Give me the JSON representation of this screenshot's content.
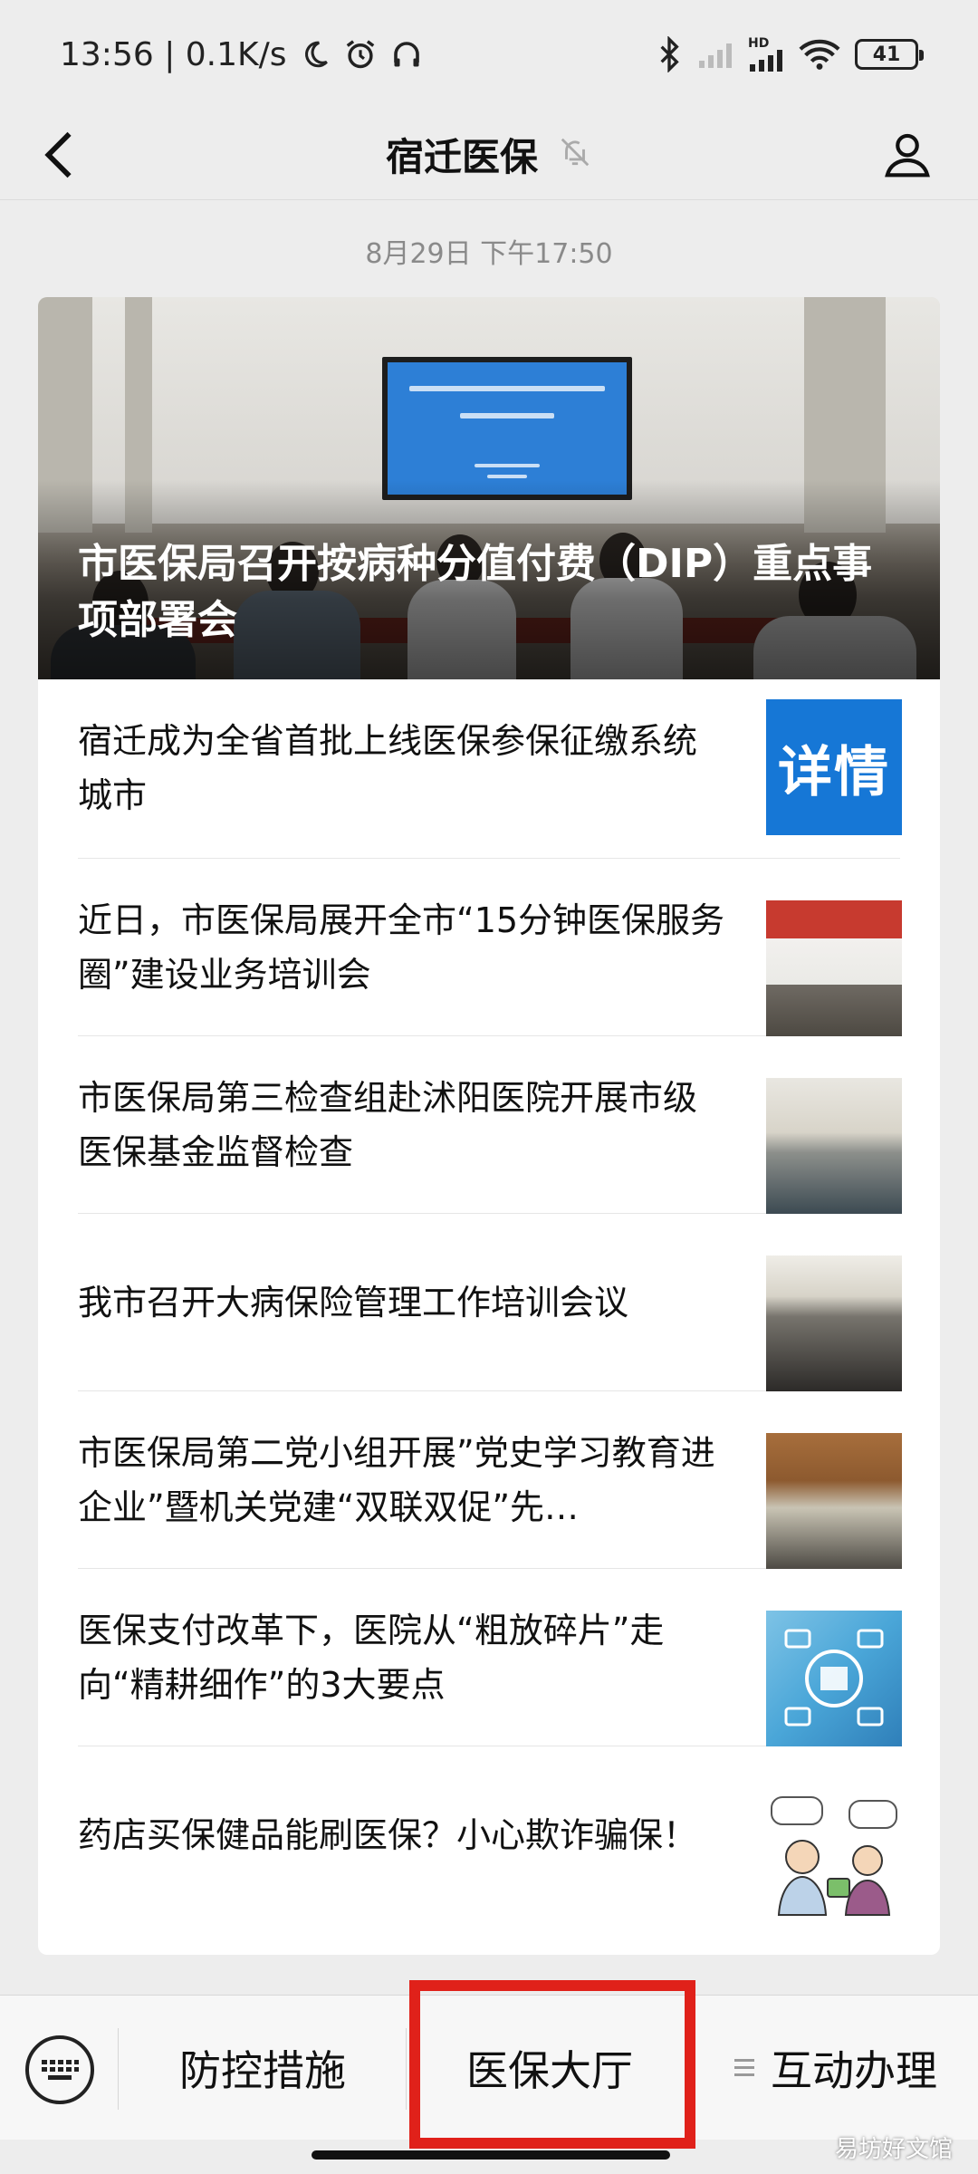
{
  "status_bar": {
    "time_speed": "13:56 | 0.1K/s",
    "network": "HD",
    "battery": "41"
  },
  "nav": {
    "title": "宿迁医保"
  },
  "timestamp": "8月29日 下午17:50",
  "hero": {
    "title": "市医保局召开按病种分值付费（DIP）重点事项部署会"
  },
  "news": [
    {
      "title": "宿迁成为全省首批上线医保参保征缴系统城市",
      "thumb_text": "详情"
    },
    {
      "title": "近日，市医保局展开全市“15分钟医保服务圈”建设业务培训会"
    },
    {
      "title": "市医保局第三检查组赴沭阳医院开展市级医保基金监督检查"
    },
    {
      "title": "我市召开大病保险管理工作培训会议"
    },
    {
      "title": "市医保局第二党小组开展”党史学习教育进企业”暨机关党建“双联双促”先…"
    },
    {
      "title": "医保支付改革下，医院从“粗放碎片”走向“精耕细作”的3大要点"
    },
    {
      "title": "药店买保健品能刷医保？小心欺诈骗保！"
    }
  ],
  "menu": {
    "items": [
      "防控措施",
      "医保大厅",
      "互动办理"
    ]
  },
  "watermark": "易坊好文馆",
  "colors": {
    "highlight": "#e0211a",
    "thumb_detail_bg": "#1677d6"
  }
}
